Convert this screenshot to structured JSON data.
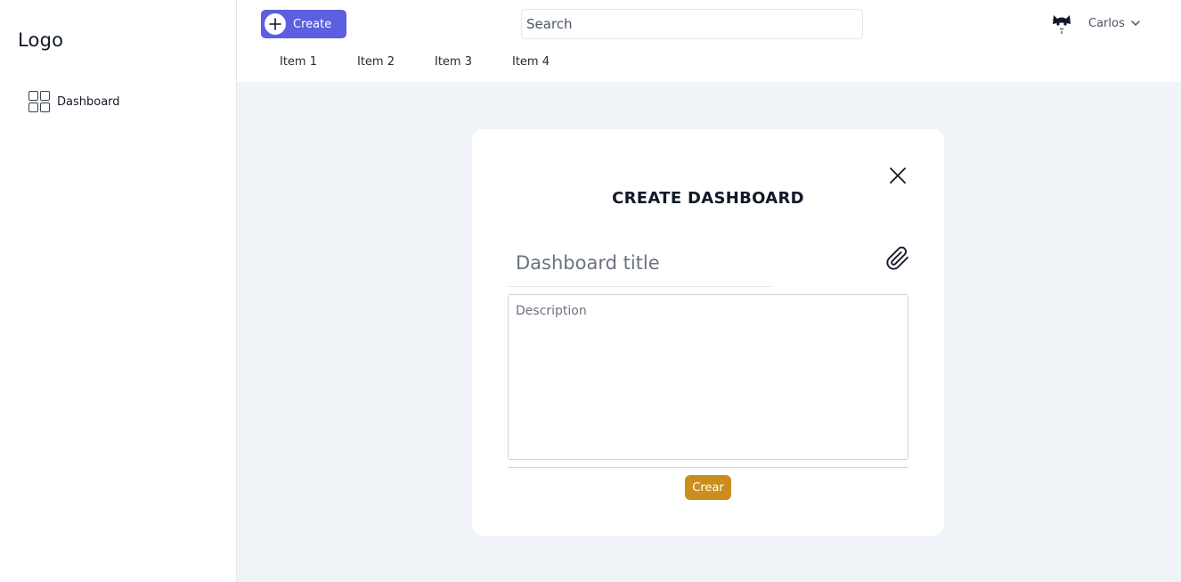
{
  "sidebar": {
    "logo": "Logo",
    "items": [
      {
        "label": "Dashboard",
        "icon": "grid-icon"
      }
    ]
  },
  "header": {
    "create_label": "Create",
    "search_placeholder": "Search",
    "user_name": "Carlos",
    "tabs": [
      "Item 1",
      "Item 2",
      "Item 3",
      "Item 4"
    ]
  },
  "modal": {
    "title": "CREATE DASHBOARD",
    "title_placeholder": "Dashboard title",
    "description_placeholder": "Description",
    "submit_label": "Crear"
  },
  "colors": {
    "primary": "#5b5fe0",
    "submit": "#cb8e1d",
    "background": "#f0f3f8"
  }
}
